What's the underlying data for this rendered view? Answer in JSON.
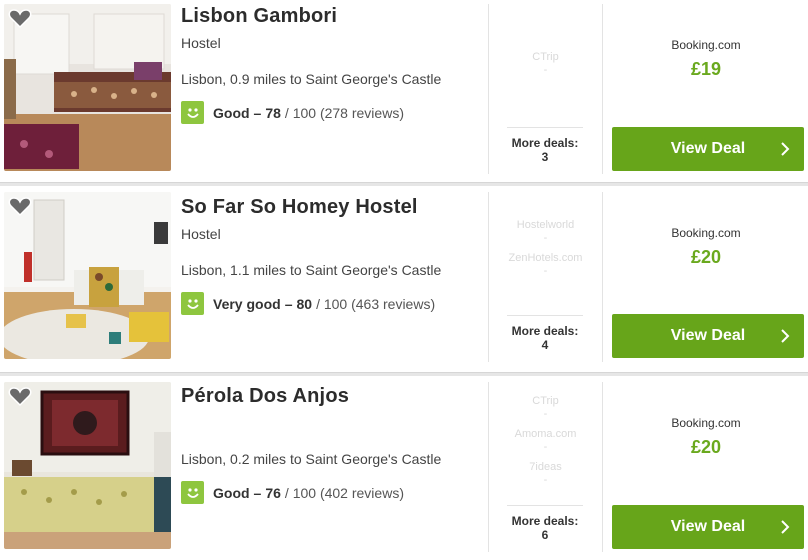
{
  "listings": [
    {
      "name": "Lisbon Gambori",
      "type": "Hostel",
      "location": "Lisbon, 0.9 miles to Saint George's Castle",
      "rating_label": "Good",
      "rating_dash": "–",
      "rating_score": "78",
      "rating_rest": "/ 100 (278 reviews)",
      "deals": [
        {
          "name": "CTrip",
          "price": "-"
        }
      ],
      "more_deals": "More deals: 3",
      "best_provider": "Booking.com",
      "best_price": "£19",
      "cta": "View Deal"
    },
    {
      "name": "So Far So Homey Hostel",
      "type": "Hostel",
      "location": "Lisbon, 1.1 miles to Saint George's Castle",
      "rating_label": "Very good",
      "rating_dash": "–",
      "rating_score": "80",
      "rating_rest": "/ 100 (463 reviews)",
      "deals": [
        {
          "name": "Hostelworld",
          "price": "-"
        },
        {
          "name": "ZenHotels.com",
          "price": "-"
        }
      ],
      "more_deals": "More deals: 4",
      "best_provider": "Booking.com",
      "best_price": "£20",
      "cta": "View Deal"
    },
    {
      "name": "Pérola Dos Anjos",
      "type": "",
      "location": "Lisbon, 0.2 miles to Saint George's Castle",
      "rating_label": "Good",
      "rating_dash": "–",
      "rating_score": "76",
      "rating_rest": "/ 100 (402 reviews)",
      "deals": [
        {
          "name": "CTrip",
          "price": "-"
        },
        {
          "name": "Amoma.com",
          "price": "-"
        },
        {
          "name": "7ideas",
          "price": "-"
        }
      ],
      "more_deals": "More deals: 6",
      "best_provider": "Booking.com",
      "best_price": "£20",
      "cta": "View Deal"
    }
  ],
  "colors": {
    "accent_green": "#67a51a",
    "price_green": "#6aa91e",
    "smiley_green": "#8ec63f"
  }
}
